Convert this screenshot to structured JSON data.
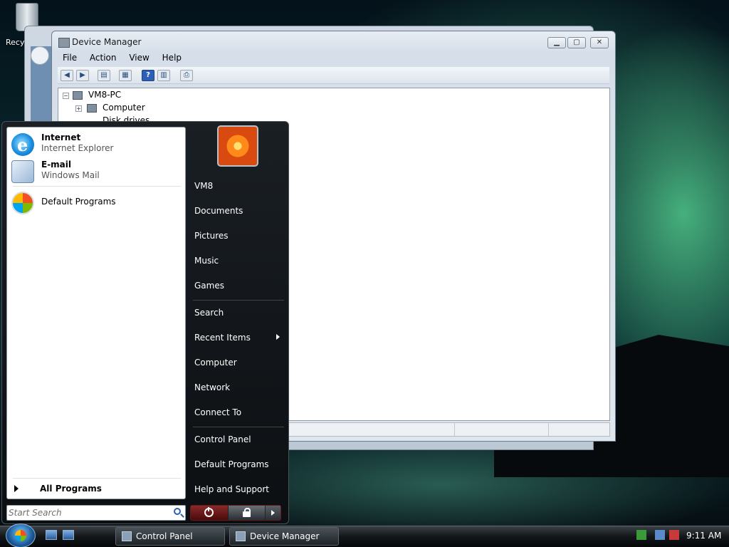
{
  "desktop": {
    "recycle_bin_label": "Recy"
  },
  "device_manager": {
    "title": "Device Manager",
    "menu": [
      "File",
      "Action",
      "View",
      "Help"
    ],
    "tree": {
      "root": "VM8-PC",
      "children": [
        "Computer",
        "Disk drives"
      ]
    }
  },
  "start_menu": {
    "pinned": [
      {
        "title": "Internet",
        "subtitle": "Internet Explorer",
        "icon": "internet-explorer-icon"
      },
      {
        "title": "E-mail",
        "subtitle": "Windows Mail",
        "icon": "windows-mail-icon"
      }
    ],
    "recent": [
      {
        "label": "Default Programs",
        "icon": "default-programs-icon"
      }
    ],
    "all_programs_label": "All Programs",
    "search_placeholder": "Start Search",
    "right_items": [
      "VM8",
      "Documents",
      "Pictures",
      "Music",
      "Games",
      "Search",
      "Recent Items",
      "Computer",
      "Network",
      "Connect To",
      "Control Panel",
      "Default Programs",
      "Help and Support"
    ]
  },
  "taskbar": {
    "buttons": [
      "Control Panel",
      "Device Manager"
    ],
    "clock": "9:11 AM"
  }
}
